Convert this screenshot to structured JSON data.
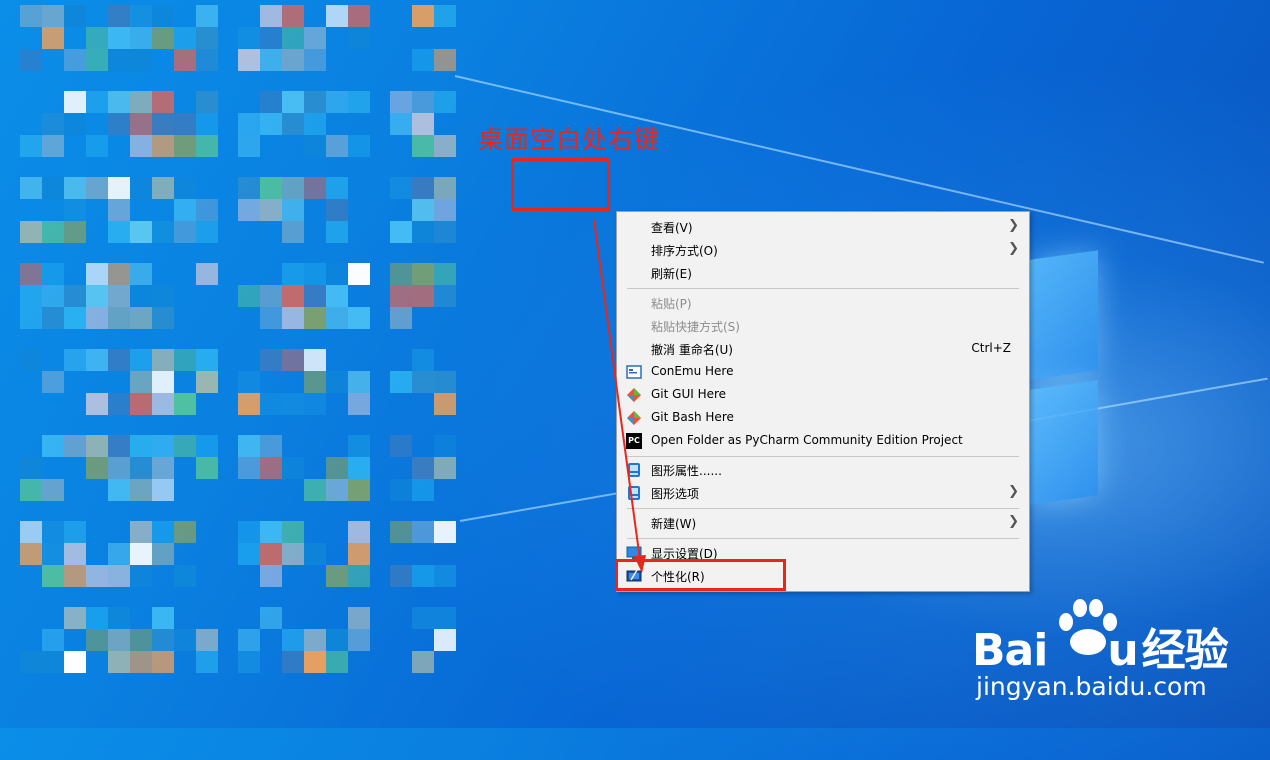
{
  "annotation": {
    "callout_text": "桌面空白处右键"
  },
  "context_menu": {
    "items": [
      {
        "label": "查看(V)",
        "arrow": true
      },
      {
        "label": "排序方式(O)",
        "arrow": true
      },
      {
        "label": "刷新(E)"
      },
      {
        "label": "粘贴(P)",
        "disabled": true
      },
      {
        "label": "粘贴快捷方式(S)",
        "disabled": true
      },
      {
        "label": "撤消 重命名(U)",
        "shortcut": "Ctrl+Z"
      },
      {
        "label": "ConEmu Here",
        "icon": "conemu-icon"
      },
      {
        "label": "Git GUI Here",
        "icon": "git-icon"
      },
      {
        "label": "Git Bash Here",
        "icon": "git-icon"
      },
      {
        "label": "Open Folder as PyCharm Community Edition Project",
        "icon": "pycharm-icon",
        "icon_text": "PC"
      },
      {
        "label": "图形属性......",
        "icon": "graphics-icon"
      },
      {
        "label": "图形选项",
        "icon": "graphics-icon",
        "arrow": true
      },
      {
        "label": "新建(W)",
        "arrow": true
      },
      {
        "label": "显示设置(D)",
        "icon": "display-icon"
      },
      {
        "label": "个性化(R)",
        "icon": "personalize-icon"
      }
    ]
  },
  "watermark": {
    "brand_left": "Bai",
    "brand_right": "u",
    "brand_cn": "经验",
    "url": "jingyan.baidu.com"
  },
  "colors": {
    "annotation_red": "#e8261b",
    "desktop_blue": "#0a7fe0",
    "menu_bg": "#f2f2f2"
  }
}
